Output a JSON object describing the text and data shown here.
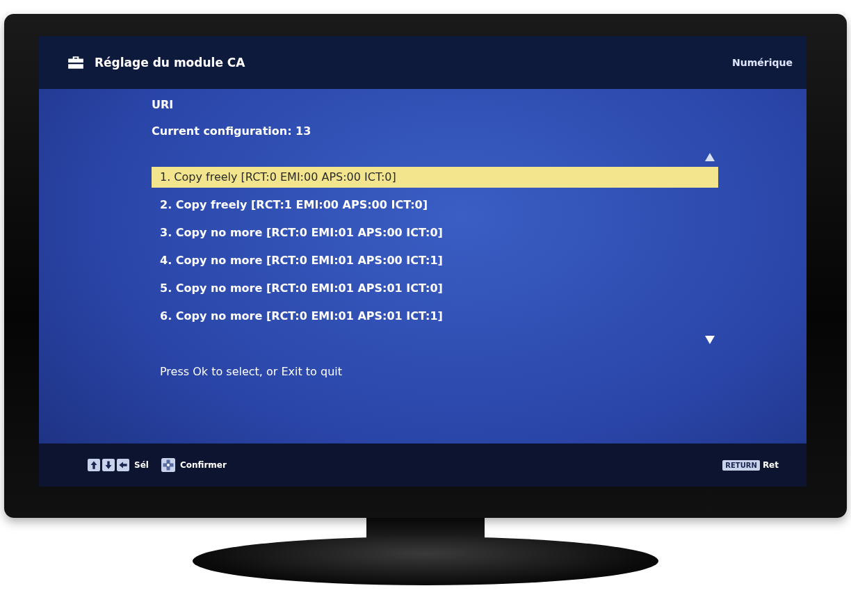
{
  "header": {
    "title": "Réglage du module CA",
    "source": "Numérique"
  },
  "menu": {
    "heading": "URI",
    "current": "Current configuration: 13",
    "items": [
      {
        "label": "1. Copy freely [RCT:0 EMI:00 APS:00 ICT:0]",
        "selected": true
      },
      {
        "label": "2. Copy freely [RCT:1 EMI:00 APS:00 ICT:0]",
        "selected": false
      },
      {
        "label": "3. Copy no more [RCT:0 EMI:01 APS:00 ICT:0]",
        "selected": false
      },
      {
        "label": "4. Copy no more [RCT:0 EMI:01 APS:00 ICT:1]",
        "selected": false
      },
      {
        "label": "5. Copy no more [RCT:0 EMI:01 APS:01 ICT:0]",
        "selected": false
      },
      {
        "label": "6. Copy no more [RCT:0 EMI:01 APS:01 ICT:1]",
        "selected": false
      }
    ],
    "hint": "Press Ok to select, or Exit to quit"
  },
  "footer": {
    "hints": [
      {
        "kind": "arrows",
        "label": "Sél"
      },
      {
        "kind": "pad",
        "label": "Confirmer"
      }
    ],
    "return_key": "RETURN",
    "return_label": "Ret"
  }
}
